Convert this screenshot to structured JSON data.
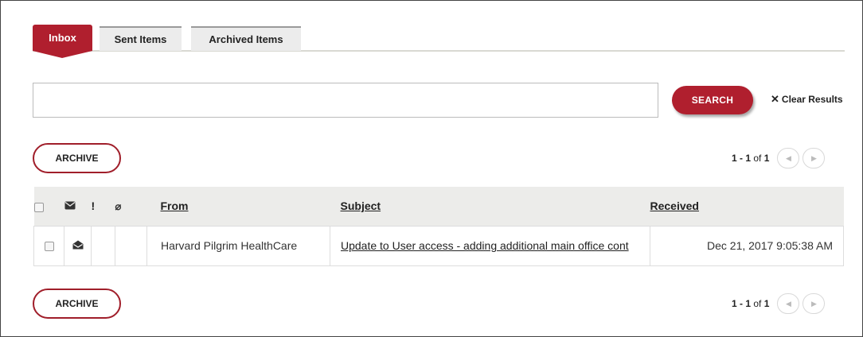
{
  "tabs": [
    {
      "label": "Inbox",
      "active": true
    },
    {
      "label": "Sent Items",
      "active": false
    },
    {
      "label": "Archived Items",
      "active": false
    }
  ],
  "search": {
    "value": "",
    "button_label": "SEARCH",
    "clear_label": "Clear Results"
  },
  "toolbar": {
    "archive_label": "ARCHIVE"
  },
  "pagination": {
    "range": "1 - 1",
    "of_label": "of",
    "total": "1",
    "prev_icon": "chevron-left-icon",
    "next_icon": "chevron-right-icon"
  },
  "table": {
    "headers": {
      "read": "envelope-icon",
      "importance": "!",
      "attachment": "paperclip-icon",
      "from": "From",
      "subject": "Subject",
      "received": "Received"
    },
    "rows": [
      {
        "read_icon": "open-envelope-icon",
        "importance": "",
        "attachment": "",
        "from": "Harvard Pilgrim HealthCare",
        "subject": "Update to User access - adding additional main office cont",
        "received": "Dec 21, 2017 9:05:38 AM"
      }
    ]
  },
  "colors": {
    "accent": "#b01f2e",
    "header_bg": "#ececea"
  }
}
